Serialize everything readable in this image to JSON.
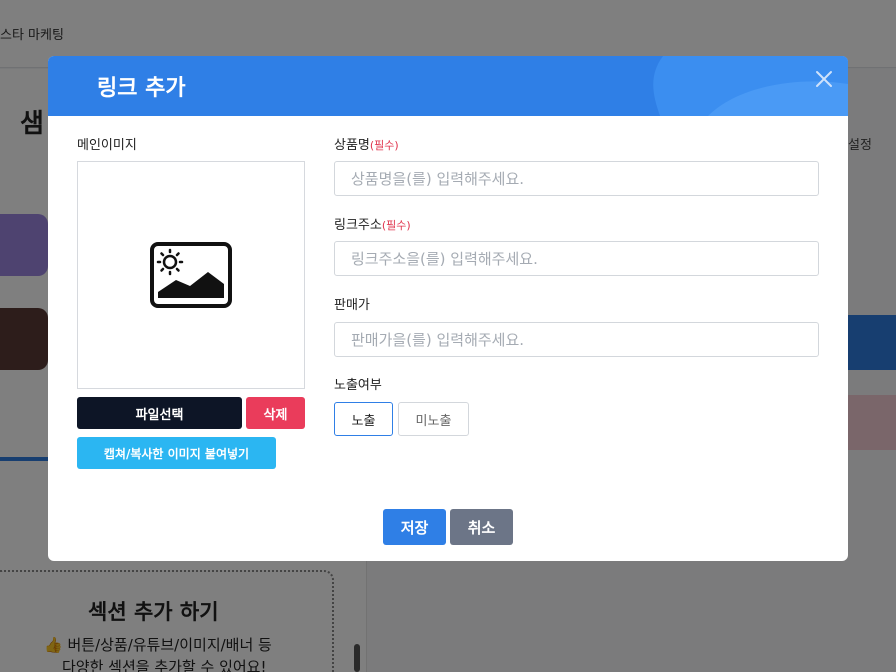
{
  "background": {
    "topbar_title": "스타 마케팅",
    "section_heading": "샘",
    "settings_label": "설정",
    "add_section_title": "섹션 추가 하기",
    "add_section_line1": "버튼/상품/유튜브/이미지/배너 등",
    "add_section_line2": "다양한 섹션을 추가할 수 있어요!"
  },
  "modal": {
    "title": "링크 추가",
    "main_image_label": "메인이미지",
    "file_select_label": "파일선택",
    "delete_label": "삭제",
    "paste_label": "캡쳐/복사한 이미지 붙여넣기",
    "required_text": "(필수)",
    "fields": {
      "product_name": {
        "label": "상품명",
        "placeholder": "상품명을(를) 입력해주세요.",
        "value": ""
      },
      "link_url": {
        "label": "링크주소",
        "placeholder": "링크주소을(를) 입력해주세요.",
        "value": ""
      },
      "price": {
        "label": "판매가",
        "placeholder": "판매가을(를) 입력해주세요.",
        "value": ""
      }
    },
    "visibility": {
      "label": "노출여부",
      "options": [
        "노출",
        "미노출"
      ],
      "selected": "노출"
    },
    "save_label": "저장",
    "cancel_label": "취소"
  },
  "colors": {
    "primary": "#2f7fe6",
    "danger": "#ea3c5b",
    "info": "#2bb6f2",
    "dark": "#0d1526",
    "muted": "#6c7587"
  }
}
